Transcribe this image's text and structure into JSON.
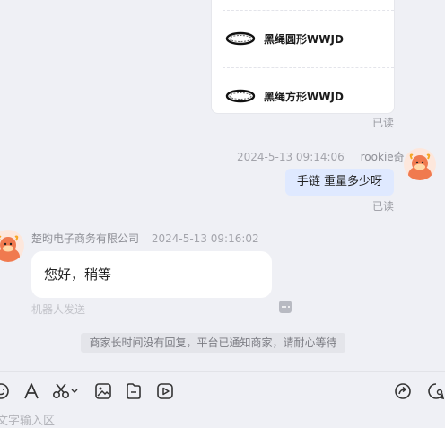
{
  "products": [
    {
      "name": "黑绳圆形WWJD",
      "icon": "bracelet-icon"
    },
    {
      "name": "黑绳方形WWJD",
      "icon": "bracelet-icon"
    }
  ],
  "read_status_1": "已读",
  "outgoing": {
    "timestamp": "2024-5-13 09:14:06",
    "sender": "rookie奇",
    "text": "手链  重量多少呀",
    "read_status": "已读"
  },
  "incoming": {
    "sender": "楚昀电子商务有限公司",
    "timestamp": "2024-5-13 09:16:02",
    "text": "您好，稍等",
    "tag": "机器人发送"
  },
  "system_notice": "商家长时间没有回复，平台已通知商家，请耐心等待",
  "toolbar": {
    "left_icons": [
      "emoji-icon",
      "font-icon",
      "scissors-icon",
      "image-icon",
      "file-icon",
      "video-icon"
    ],
    "right_icons": [
      "share-icon",
      "chat-settings-icon"
    ]
  },
  "input": {
    "placeholder": "文字输入区"
  },
  "colors": {
    "background": "#eff0f5",
    "outgoing_bubble": "#dfe9ff",
    "avatar": "#f07a4f"
  }
}
